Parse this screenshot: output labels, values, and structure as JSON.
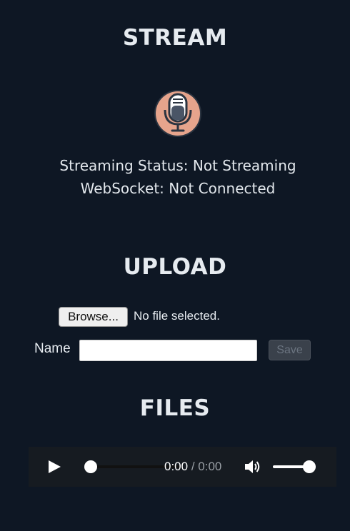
{
  "stream": {
    "heading": "STREAM",
    "mic_icon": "microphone-icon",
    "streaming_status": "Streaming Status: Not Streaming",
    "websocket_status": "WebSocket: Not Connected"
  },
  "upload": {
    "heading": "UPLOAD",
    "browse_label": "Browse...",
    "file_status": "No file selected.",
    "name_label": "Name",
    "name_value": "",
    "save_label": "Save"
  },
  "files": {
    "heading": "FILES",
    "player": {
      "current_time": "0:00",
      "separator": " / ",
      "duration": "0:00",
      "progress": 0,
      "volume": 1.0
    }
  },
  "colors": {
    "background": "#0e1724",
    "mic_badge": "#e6a48c",
    "mic_body": "#4a5566",
    "player_bg": "#161b21"
  }
}
